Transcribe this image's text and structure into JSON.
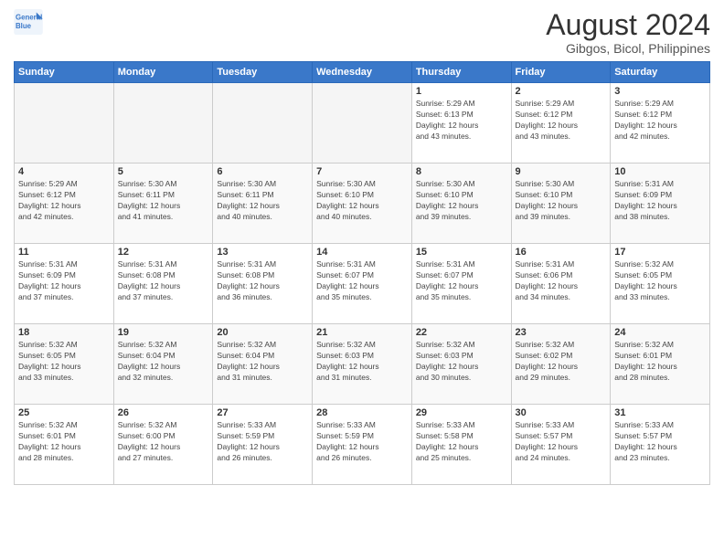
{
  "logo": {
    "line1": "General",
    "line2": "Blue"
  },
  "title": "August 2024",
  "subtitle": "Gibgos, Bicol, Philippines",
  "weekdays": [
    "Sunday",
    "Monday",
    "Tuesday",
    "Wednesday",
    "Thursday",
    "Friday",
    "Saturday"
  ],
  "weeks": [
    [
      {
        "day": "",
        "info": ""
      },
      {
        "day": "",
        "info": ""
      },
      {
        "day": "",
        "info": ""
      },
      {
        "day": "",
        "info": ""
      },
      {
        "day": "1",
        "info": "Sunrise: 5:29 AM\nSunset: 6:13 PM\nDaylight: 12 hours\nand 43 minutes."
      },
      {
        "day": "2",
        "info": "Sunrise: 5:29 AM\nSunset: 6:12 PM\nDaylight: 12 hours\nand 43 minutes."
      },
      {
        "day": "3",
        "info": "Sunrise: 5:29 AM\nSunset: 6:12 PM\nDaylight: 12 hours\nand 42 minutes."
      }
    ],
    [
      {
        "day": "4",
        "info": "Sunrise: 5:29 AM\nSunset: 6:12 PM\nDaylight: 12 hours\nand 42 minutes."
      },
      {
        "day": "5",
        "info": "Sunrise: 5:30 AM\nSunset: 6:11 PM\nDaylight: 12 hours\nand 41 minutes."
      },
      {
        "day": "6",
        "info": "Sunrise: 5:30 AM\nSunset: 6:11 PM\nDaylight: 12 hours\nand 40 minutes."
      },
      {
        "day": "7",
        "info": "Sunrise: 5:30 AM\nSunset: 6:10 PM\nDaylight: 12 hours\nand 40 minutes."
      },
      {
        "day": "8",
        "info": "Sunrise: 5:30 AM\nSunset: 6:10 PM\nDaylight: 12 hours\nand 39 minutes."
      },
      {
        "day": "9",
        "info": "Sunrise: 5:30 AM\nSunset: 6:10 PM\nDaylight: 12 hours\nand 39 minutes."
      },
      {
        "day": "10",
        "info": "Sunrise: 5:31 AM\nSunset: 6:09 PM\nDaylight: 12 hours\nand 38 minutes."
      }
    ],
    [
      {
        "day": "11",
        "info": "Sunrise: 5:31 AM\nSunset: 6:09 PM\nDaylight: 12 hours\nand 37 minutes."
      },
      {
        "day": "12",
        "info": "Sunrise: 5:31 AM\nSunset: 6:08 PM\nDaylight: 12 hours\nand 37 minutes."
      },
      {
        "day": "13",
        "info": "Sunrise: 5:31 AM\nSunset: 6:08 PM\nDaylight: 12 hours\nand 36 minutes."
      },
      {
        "day": "14",
        "info": "Sunrise: 5:31 AM\nSunset: 6:07 PM\nDaylight: 12 hours\nand 35 minutes."
      },
      {
        "day": "15",
        "info": "Sunrise: 5:31 AM\nSunset: 6:07 PM\nDaylight: 12 hours\nand 35 minutes."
      },
      {
        "day": "16",
        "info": "Sunrise: 5:31 AM\nSunset: 6:06 PM\nDaylight: 12 hours\nand 34 minutes."
      },
      {
        "day": "17",
        "info": "Sunrise: 5:32 AM\nSunset: 6:05 PM\nDaylight: 12 hours\nand 33 minutes."
      }
    ],
    [
      {
        "day": "18",
        "info": "Sunrise: 5:32 AM\nSunset: 6:05 PM\nDaylight: 12 hours\nand 33 minutes."
      },
      {
        "day": "19",
        "info": "Sunrise: 5:32 AM\nSunset: 6:04 PM\nDaylight: 12 hours\nand 32 minutes."
      },
      {
        "day": "20",
        "info": "Sunrise: 5:32 AM\nSunset: 6:04 PM\nDaylight: 12 hours\nand 31 minutes."
      },
      {
        "day": "21",
        "info": "Sunrise: 5:32 AM\nSunset: 6:03 PM\nDaylight: 12 hours\nand 31 minutes."
      },
      {
        "day": "22",
        "info": "Sunrise: 5:32 AM\nSunset: 6:03 PM\nDaylight: 12 hours\nand 30 minutes."
      },
      {
        "day": "23",
        "info": "Sunrise: 5:32 AM\nSunset: 6:02 PM\nDaylight: 12 hours\nand 29 minutes."
      },
      {
        "day": "24",
        "info": "Sunrise: 5:32 AM\nSunset: 6:01 PM\nDaylight: 12 hours\nand 28 minutes."
      }
    ],
    [
      {
        "day": "25",
        "info": "Sunrise: 5:32 AM\nSunset: 6:01 PM\nDaylight: 12 hours\nand 28 minutes."
      },
      {
        "day": "26",
        "info": "Sunrise: 5:32 AM\nSunset: 6:00 PM\nDaylight: 12 hours\nand 27 minutes."
      },
      {
        "day": "27",
        "info": "Sunrise: 5:33 AM\nSunset: 5:59 PM\nDaylight: 12 hours\nand 26 minutes."
      },
      {
        "day": "28",
        "info": "Sunrise: 5:33 AM\nSunset: 5:59 PM\nDaylight: 12 hours\nand 26 minutes."
      },
      {
        "day": "29",
        "info": "Sunrise: 5:33 AM\nSunset: 5:58 PM\nDaylight: 12 hours\nand 25 minutes."
      },
      {
        "day": "30",
        "info": "Sunrise: 5:33 AM\nSunset: 5:57 PM\nDaylight: 12 hours\nand 24 minutes."
      },
      {
        "day": "31",
        "info": "Sunrise: 5:33 AM\nSunset: 5:57 PM\nDaylight: 12 hours\nand 23 minutes."
      }
    ]
  ]
}
